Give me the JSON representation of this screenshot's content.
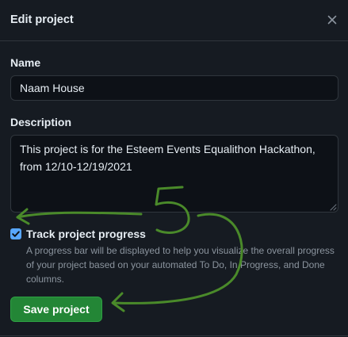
{
  "dialog": {
    "title": "Edit project",
    "close_icon": "close-icon"
  },
  "form": {
    "name_label": "Name",
    "name_value": "Naam House",
    "description_label": "Description",
    "description_value": "This project is for the Esteem Events Equalithon Hackathon, from 12/10-12/19/2021",
    "track_label": "Track project progress",
    "track_checked": true,
    "track_help": "A progress bar will be displayed to help you visualize the overall progress of your project based on your automated To Do, In Progress, and Done columns.",
    "save_label": "Save project"
  },
  "annotation": {
    "digit": "5",
    "color": "#4a8a2a"
  },
  "colors": {
    "background": "#161b22",
    "input_background": "#0d1117",
    "border": "#30363d",
    "accent_green": "#238636",
    "checkbox_blue": "#58a6ff",
    "muted_text": "#8b949e"
  }
}
